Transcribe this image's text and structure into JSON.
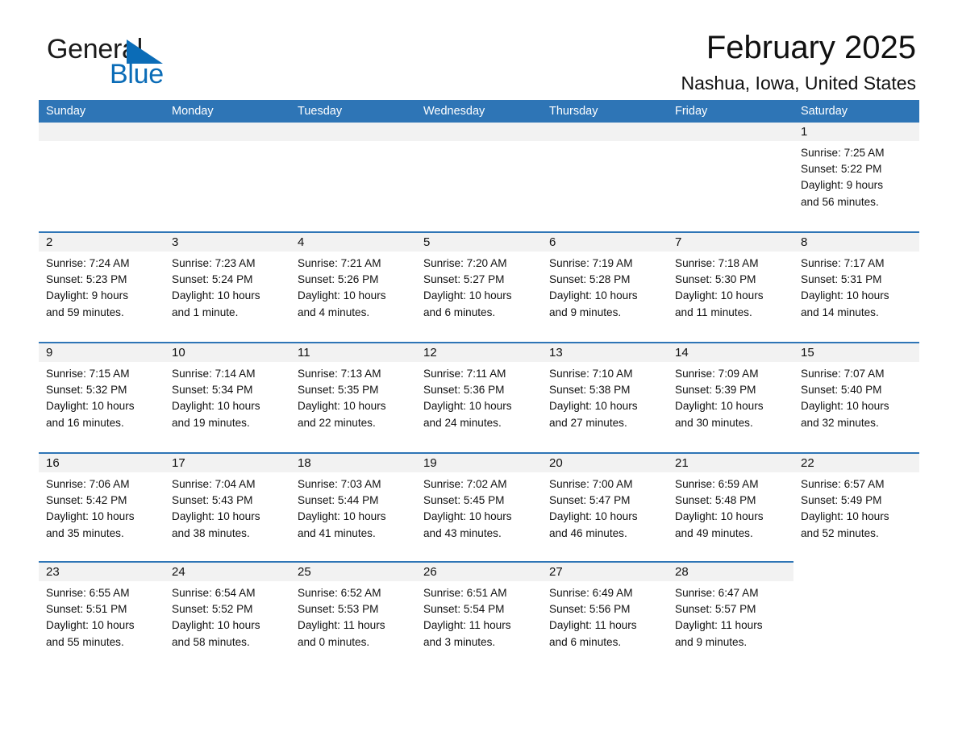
{
  "brand": {
    "name_part1": "General",
    "name_part2": "Blue",
    "accent_color": "#0b6cb7"
  },
  "header": {
    "title": "February 2025",
    "subtitle": "Nashua, Iowa, United States"
  },
  "theme": {
    "header_bar_color": "#2e75b6",
    "date_band_color": "#f2f2f2",
    "text_color": "#111111"
  },
  "calendar": {
    "weekdays": [
      "Sunday",
      "Monday",
      "Tuesday",
      "Wednesday",
      "Thursday",
      "Friday",
      "Saturday"
    ],
    "weeks": [
      [
        {
          "date": "",
          "blank": true,
          "lead": true
        },
        {
          "date": "",
          "blank": true,
          "lead": true
        },
        {
          "date": "",
          "blank": true,
          "lead": true
        },
        {
          "date": "",
          "blank": true,
          "lead": true
        },
        {
          "date": "",
          "blank": true,
          "lead": true
        },
        {
          "date": "",
          "blank": true,
          "lead": true
        },
        {
          "date": "1",
          "sunrise": "Sunrise: 7:25 AM",
          "sunset": "Sunset: 5:22 PM",
          "daylight1": "Daylight: 9 hours",
          "daylight2": "and 56 minutes."
        }
      ],
      [
        {
          "date": "2",
          "sunrise": "Sunrise: 7:24 AM",
          "sunset": "Sunset: 5:23 PM",
          "daylight1": "Daylight: 9 hours",
          "daylight2": "and 59 minutes."
        },
        {
          "date": "3",
          "sunrise": "Sunrise: 7:23 AM",
          "sunset": "Sunset: 5:24 PM",
          "daylight1": "Daylight: 10 hours",
          "daylight2": "and 1 minute."
        },
        {
          "date": "4",
          "sunrise": "Sunrise: 7:21 AM",
          "sunset": "Sunset: 5:26 PM",
          "daylight1": "Daylight: 10 hours",
          "daylight2": "and 4 minutes."
        },
        {
          "date": "5",
          "sunrise": "Sunrise: 7:20 AM",
          "sunset": "Sunset: 5:27 PM",
          "daylight1": "Daylight: 10 hours",
          "daylight2": "and 6 minutes."
        },
        {
          "date": "6",
          "sunrise": "Sunrise: 7:19 AM",
          "sunset": "Sunset: 5:28 PM",
          "daylight1": "Daylight: 10 hours",
          "daylight2": "and 9 minutes."
        },
        {
          "date": "7",
          "sunrise": "Sunrise: 7:18 AM",
          "sunset": "Sunset: 5:30 PM",
          "daylight1": "Daylight: 10 hours",
          "daylight2": "and 11 minutes."
        },
        {
          "date": "8",
          "sunrise": "Sunrise: 7:17 AM",
          "sunset": "Sunset: 5:31 PM",
          "daylight1": "Daylight: 10 hours",
          "daylight2": "and 14 minutes."
        }
      ],
      [
        {
          "date": "9",
          "sunrise": "Sunrise: 7:15 AM",
          "sunset": "Sunset: 5:32 PM",
          "daylight1": "Daylight: 10 hours",
          "daylight2": "and 16 minutes."
        },
        {
          "date": "10",
          "sunrise": "Sunrise: 7:14 AM",
          "sunset": "Sunset: 5:34 PM",
          "daylight1": "Daylight: 10 hours",
          "daylight2": "and 19 minutes."
        },
        {
          "date": "11",
          "sunrise": "Sunrise: 7:13 AM",
          "sunset": "Sunset: 5:35 PM",
          "daylight1": "Daylight: 10 hours",
          "daylight2": "and 22 minutes."
        },
        {
          "date": "12",
          "sunrise": "Sunrise: 7:11 AM",
          "sunset": "Sunset: 5:36 PM",
          "daylight1": "Daylight: 10 hours",
          "daylight2": "and 24 minutes."
        },
        {
          "date": "13",
          "sunrise": "Sunrise: 7:10 AM",
          "sunset": "Sunset: 5:38 PM",
          "daylight1": "Daylight: 10 hours",
          "daylight2": "and 27 minutes."
        },
        {
          "date": "14",
          "sunrise": "Sunrise: 7:09 AM",
          "sunset": "Sunset: 5:39 PM",
          "daylight1": "Daylight: 10 hours",
          "daylight2": "and 30 minutes."
        },
        {
          "date": "15",
          "sunrise": "Sunrise: 7:07 AM",
          "sunset": "Sunset: 5:40 PM",
          "daylight1": "Daylight: 10 hours",
          "daylight2": "and 32 minutes."
        }
      ],
      [
        {
          "date": "16",
          "sunrise": "Sunrise: 7:06 AM",
          "sunset": "Sunset: 5:42 PM",
          "daylight1": "Daylight: 10 hours",
          "daylight2": "and 35 minutes."
        },
        {
          "date": "17",
          "sunrise": "Sunrise: 7:04 AM",
          "sunset": "Sunset: 5:43 PM",
          "daylight1": "Daylight: 10 hours",
          "daylight2": "and 38 minutes."
        },
        {
          "date": "18",
          "sunrise": "Sunrise: 7:03 AM",
          "sunset": "Sunset: 5:44 PM",
          "daylight1": "Daylight: 10 hours",
          "daylight2": "and 41 minutes."
        },
        {
          "date": "19",
          "sunrise": "Sunrise: 7:02 AM",
          "sunset": "Sunset: 5:45 PM",
          "daylight1": "Daylight: 10 hours",
          "daylight2": "and 43 minutes."
        },
        {
          "date": "20",
          "sunrise": "Sunrise: 7:00 AM",
          "sunset": "Sunset: 5:47 PM",
          "daylight1": "Daylight: 10 hours",
          "daylight2": "and 46 minutes."
        },
        {
          "date": "21",
          "sunrise": "Sunrise: 6:59 AM",
          "sunset": "Sunset: 5:48 PM",
          "daylight1": "Daylight: 10 hours",
          "daylight2": "and 49 minutes."
        },
        {
          "date": "22",
          "sunrise": "Sunrise: 6:57 AM",
          "sunset": "Sunset: 5:49 PM",
          "daylight1": "Daylight: 10 hours",
          "daylight2": "and 52 minutes."
        }
      ],
      [
        {
          "date": "23",
          "sunrise": "Sunrise: 6:55 AM",
          "sunset": "Sunset: 5:51 PM",
          "daylight1": "Daylight: 10 hours",
          "daylight2": "and 55 minutes."
        },
        {
          "date": "24",
          "sunrise": "Sunrise: 6:54 AM",
          "sunset": "Sunset: 5:52 PM",
          "daylight1": "Daylight: 10 hours",
          "daylight2": "and 58 minutes."
        },
        {
          "date": "25",
          "sunrise": "Sunrise: 6:52 AM",
          "sunset": "Sunset: 5:53 PM",
          "daylight1": "Daylight: 11 hours",
          "daylight2": "and 0 minutes."
        },
        {
          "date": "26",
          "sunrise": "Sunrise: 6:51 AM",
          "sunset": "Sunset: 5:54 PM",
          "daylight1": "Daylight: 11 hours",
          "daylight2": "and 3 minutes."
        },
        {
          "date": "27",
          "sunrise": "Sunrise: 6:49 AM",
          "sunset": "Sunset: 5:56 PM",
          "daylight1": "Daylight: 11 hours",
          "daylight2": "and 6 minutes."
        },
        {
          "date": "28",
          "sunrise": "Sunrise: 6:47 AM",
          "sunset": "Sunset: 5:57 PM",
          "daylight1": "Daylight: 11 hours",
          "daylight2": "and 9 minutes."
        },
        {
          "date": "",
          "blank": true,
          "trail": true
        }
      ]
    ]
  }
}
